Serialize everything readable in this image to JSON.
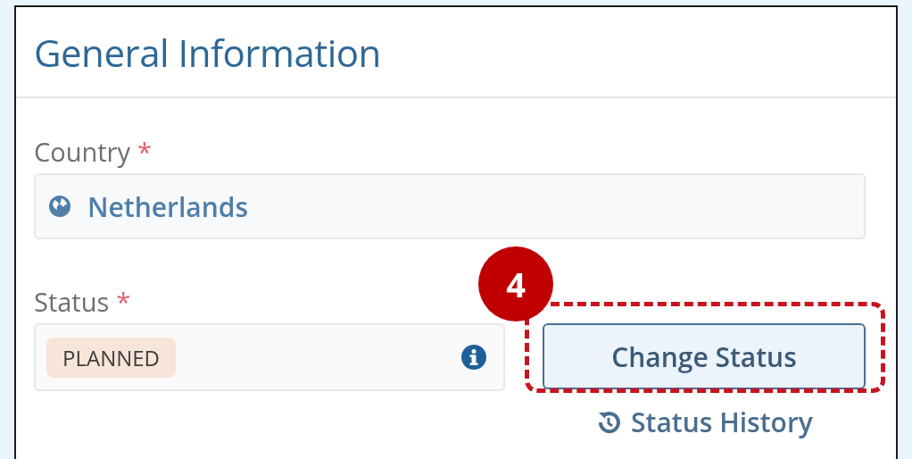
{
  "panel": {
    "title": "General Information"
  },
  "country": {
    "label": "Country",
    "required_mark": "*",
    "value": "Netherlands"
  },
  "status": {
    "label": "Status",
    "required_mark": "*",
    "value": "PLANNED"
  },
  "change_status_button": {
    "label": "Change Status"
  },
  "status_history_link": {
    "label": "Status History"
  },
  "callout": {
    "number": "4"
  }
}
